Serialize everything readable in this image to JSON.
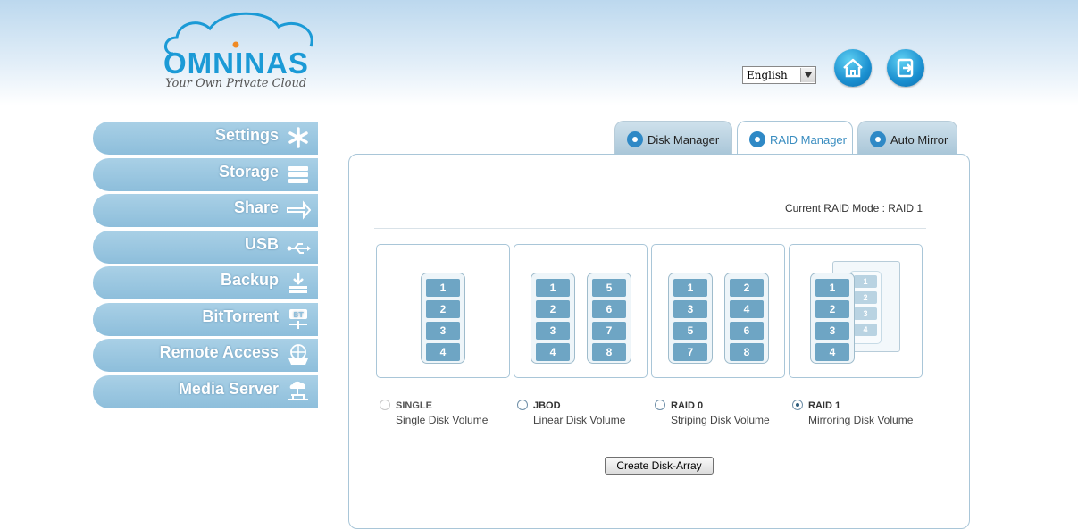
{
  "brand": {
    "name": "OMNINAS",
    "tagline": "Your Own Private Cloud"
  },
  "header": {
    "language": {
      "selected": "English"
    },
    "home_icon": "home-icon",
    "logout_icon": "logout-icon"
  },
  "sidebar": {
    "items": [
      {
        "label": "Settings",
        "icon": "settings-icon"
      },
      {
        "label": "Storage",
        "icon": "storage-icon"
      },
      {
        "label": "Share",
        "icon": "share-icon"
      },
      {
        "label": "USB",
        "icon": "usb-icon"
      },
      {
        "label": "Backup",
        "icon": "backup-icon"
      },
      {
        "label": "BitTorrent",
        "icon": "bittorrent-icon"
      },
      {
        "label": "Remote Access",
        "icon": "remote-access-icon"
      },
      {
        "label": "Media Server",
        "icon": "media-server-icon"
      }
    ]
  },
  "tabs": [
    {
      "label": "Disk Manager",
      "active": false
    },
    {
      "label": "RAID Manager",
      "active": true
    },
    {
      "label": "Auto Mirror",
      "active": false
    }
  ],
  "raid": {
    "current_mode": "Current RAID Mode : RAID 1",
    "options": [
      {
        "name": "SINGLE",
        "desc": "Single Disk Volume",
        "selected": false,
        "disabled": true
      },
      {
        "name": "JBOD",
        "desc": "Linear Disk Volume",
        "selected": false,
        "disabled": false
      },
      {
        "name": "RAID 0",
        "desc": "Striping Disk Volume",
        "selected": false,
        "disabled": false
      },
      {
        "name": "RAID 1",
        "desc": "Mirroring Disk Volume",
        "selected": true,
        "disabled": false
      }
    ],
    "diagrams": {
      "single": [
        [
          "1",
          "2",
          "3",
          "4"
        ]
      ],
      "jbod": [
        [
          "1",
          "2",
          "3",
          "4"
        ],
        [
          "5",
          "6",
          "7",
          "8"
        ]
      ],
      "raid0": [
        [
          "1",
          "3",
          "5",
          "7"
        ],
        [
          "2",
          "4",
          "6",
          "8"
        ]
      ],
      "raid1": [
        [
          "1",
          "2",
          "3",
          "4"
        ]
      ],
      "raid1_mirror": [
        "1",
        "2",
        "3",
        "4"
      ]
    },
    "create_button": "Create Disk-Array"
  },
  "colors": {
    "accent": "#1b9ad6",
    "nav": "#9cc7e0",
    "disk": "#6ea5c4"
  }
}
